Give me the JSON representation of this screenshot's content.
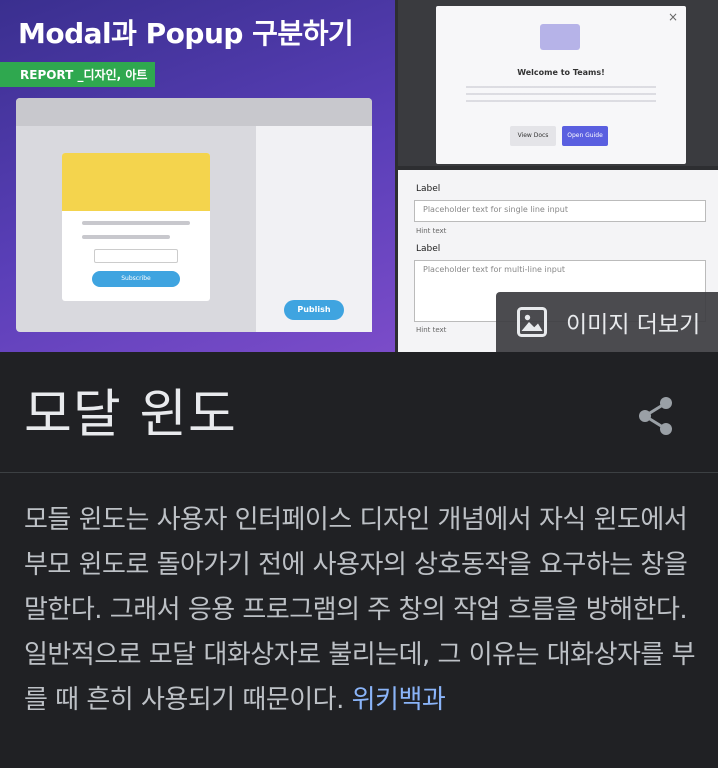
{
  "images": {
    "main": {
      "title": "Modal과 Popup 구분하기",
      "badge": "REPORT _디자인, 아트",
      "modal_button": "Subscribe",
      "publish_button": "Publish"
    },
    "top_right": {
      "title": "Welcome to Teams!",
      "secondary_button": "View Docs",
      "primary_button": "Open Guide"
    },
    "bottom_right": {
      "label1": "Label",
      "input1_placeholder": "Placeholder text for single line input",
      "hint1": "Hint text",
      "label2": "Label",
      "input2_placeholder": "Placeholder text for multi-line input",
      "hint2": "Hint text"
    },
    "more_button": {
      "label": "이미지 더보기",
      "icon": "image-icon"
    }
  },
  "knowledge_panel": {
    "title": "모달 윈도",
    "share_icon": "share-icon",
    "description": "모들 윈도는 사용자 인터페이스 디자인 개념에서 자식 윈도에서 부모 윈도로 돌아가기 전에 사용자의 상호동작을 요구하는 창을 말한다. 그래서 응용 프로그램의 주 창의 작업 흐름을 방해한다. 일반적으로 모달 대화상자로 불리는데, 그 이유는 대화상자를 부를 때 흔히 사용되기 때문이다.",
    "source_link": "위키백과"
  },
  "colors": {
    "background": "#202124",
    "text_primary": "#e8eaed",
    "text_secondary": "#bdc1c6",
    "link": "#8ab4f8"
  }
}
